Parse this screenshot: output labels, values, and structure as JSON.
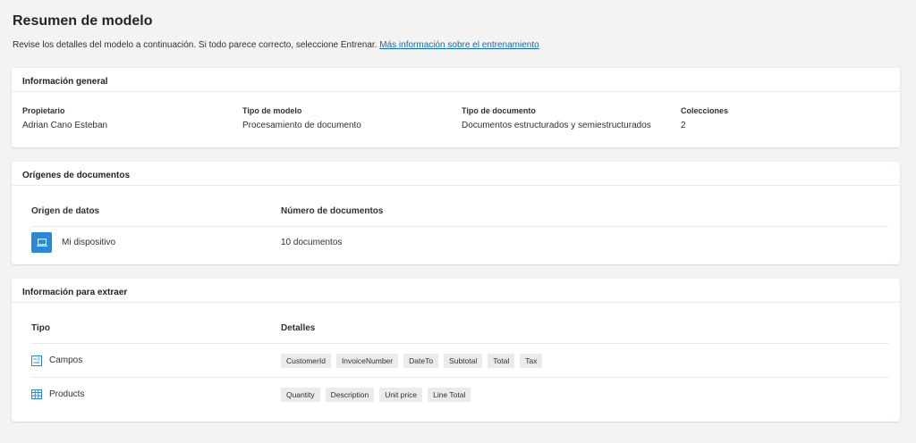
{
  "page": {
    "title": "Resumen de modelo",
    "subtitle": "Revise los detalles del modelo a continuación. Si todo parece correcto, seleccione Entrenar.",
    "link": "Más información sobre el entrenamiento"
  },
  "general": {
    "header": "Información general",
    "fields": [
      {
        "label": "Propietario",
        "value": "Adrian Cano Esteban"
      },
      {
        "label": "Tipo de modelo",
        "value": "Procesamiento de documento"
      },
      {
        "label": "Tipo de documento",
        "value": "Documentos estructurados y semiestructurados"
      },
      {
        "label": "Colecciones",
        "value": "2"
      }
    ]
  },
  "sources": {
    "header": "Orígenes de documentos",
    "col_source": "Origen de datos",
    "col_count": "Número de documentos",
    "rows": [
      {
        "icon": "laptop-icon",
        "name": "Mi dispositivo",
        "count": "10 documentos"
      }
    ]
  },
  "extract": {
    "header": "Información para extraer",
    "col_type": "Tipo",
    "col_details": "Detalles",
    "rows": [
      {
        "icon": "fields-icon",
        "name": "Campos",
        "tags": [
          "CustomerId",
          "InvoiceNumber",
          "DateTo",
          "Subtotal",
          "Total",
          "Tax"
        ]
      },
      {
        "icon": "table-icon",
        "name": "Products",
        "tags": [
          "Quantity",
          "Description",
          "Unit price",
          "Line Total"
        ]
      }
    ]
  },
  "colors": {
    "accent": "#2b88d8",
    "link": "#0f6cbd",
    "background": "#f4f3f2"
  }
}
